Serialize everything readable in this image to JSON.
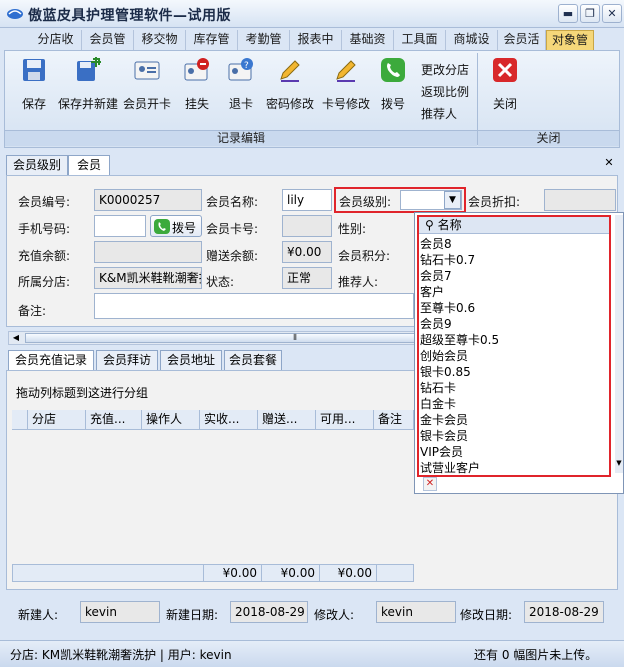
{
  "window": {
    "title": "傲蓝皮具护理管理软件—试用版",
    "min": "▬",
    "restore": "❐",
    "close": "✕"
  },
  "top_tabs": [
    "分店收",
    "会员管",
    "移交物",
    "库存管",
    "考勤管",
    "报表中",
    "基础资",
    "工具面",
    "商城设",
    "会员活",
    "对象管"
  ],
  "ribbon": {
    "buttons": [
      {
        "label": "保存",
        "icon": "floppy-disk-icon"
      },
      {
        "label": "保存并新建",
        "icon": "save-new-icon"
      },
      {
        "label": "会员开卡",
        "icon": "member-card-icon"
      },
      {
        "label": "挂失",
        "icon": "report-loss-icon"
      },
      {
        "label": "退卡",
        "icon": "return-card-icon"
      },
      {
        "label": "密码修改",
        "icon": "pencil-icon"
      },
      {
        "label": "卡号修改",
        "icon": "pencil-icon"
      },
      {
        "label": "拨号",
        "icon": "phone-icon"
      }
    ],
    "small_links": [
      "更改分店",
      "返现比例",
      "推荐人"
    ],
    "close_label": "关闭",
    "group1": "记录编辑",
    "group2": "关闭"
  },
  "sub_tabs": [
    "会员级别",
    "会员"
  ],
  "form": {
    "member_no_label": "会员编号:",
    "member_no": "K0000257",
    "member_name_label": "会员名称:",
    "member_name": "lily",
    "member_level_label": "会员级别:",
    "member_level": "",
    "discount_label": "会员折扣:",
    "phone_label": "手机号码:",
    "dial_label": "拨号",
    "card_no_label": "会员卡号:",
    "gender_label": "性别:",
    "recharge_label": "充值余额:",
    "gift_label": "赠送余额:",
    "gift_value": "¥0.00",
    "points_label": "会员积分:",
    "store_label": "所属分店:",
    "store_value": "K&M凯米鞋靴潮奢护",
    "status_label": "状态:",
    "status_value": "正常",
    "referrer_label": "推荐人:",
    "remark_label": "备注:"
  },
  "detail_tabs": [
    "会员充值记录",
    "会员拜访",
    "会员地址",
    "会员套餐"
  ],
  "group_hint": "拖动列标题到这进行分组",
  "columns": [
    "分店",
    "充值...",
    "操作人",
    "实收...",
    "赠送...",
    "可用...",
    "备注"
  ],
  "totals": [
    "¥0.00",
    "¥0.00",
    "¥0.00"
  ],
  "footer": {
    "creator_label": "新建人:",
    "creator": "kevin",
    "created_label": "新建日期:",
    "created": "2018-08-29",
    "modifier_label": "修改人:",
    "modifier": "kevin",
    "modified_label": "修改日期:",
    "modified": "2018-08-29"
  },
  "statusbar": {
    "left": "分店: KM凯米鞋靴潮奢洗护  | 用户: kevin",
    "right": "还有 0 幅图片未上传。"
  },
  "dropdown": {
    "header": "名称",
    "items": [
      "会员8",
      "钻石卡0.7",
      "会员7",
      "客户",
      "至尊卡0.6",
      "会员9",
      "超级至尊卡0.5",
      "创始会员",
      "银卡0.85",
      "钻石卡",
      "白金卡",
      "金卡会员",
      "银卡会员",
      "VIP会员",
      "试营业客户"
    ]
  },
  "colors": {
    "accent": "#f5d77a",
    "highlight": "#e0242b"
  }
}
